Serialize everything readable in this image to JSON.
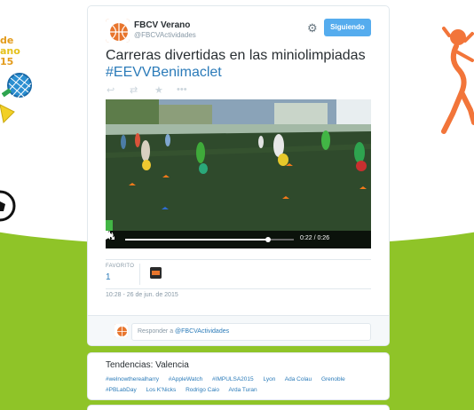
{
  "tweet": {
    "author_name": "FBCV Verano",
    "author_handle": "@FBCVActividades",
    "follow_label": "Siguiendo",
    "text_main": "Carreras divertidas en las miniolimpiadas",
    "hashtag": "#EEVVBenimaclet",
    "favorites_label": "FAVORITO",
    "favorites_count": "1",
    "date": "10:28 - 26 de jun. de 2015"
  },
  "video": {
    "time": "0:22 / 0:26",
    "progress": 0.846
  },
  "reply": {
    "prefix": "Responder a",
    "mention": "@FBCVActividades"
  },
  "trends": {
    "title": "Tendencias: Valencia",
    "items": [
      "#welnowtherealharry",
      "#AppleWatch",
      "#IMPULSA2015",
      "Lyon",
      "Ada Colau",
      "Grenoble",
      "#PBLabDay",
      "Los K'Nicks",
      "Rodrigo Caio",
      "Arda Turan"
    ]
  },
  "decor": {
    "left_logo_text": "de\nano\n15"
  },
  "colors": {
    "accent": "#55acee",
    "link": "#2b7bb9",
    "background_green": "#8fc428",
    "brand_orange": "#e8752d"
  }
}
